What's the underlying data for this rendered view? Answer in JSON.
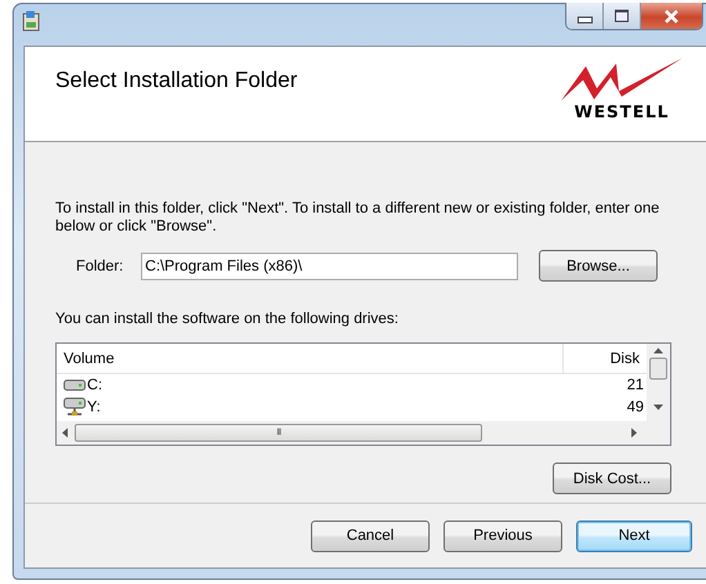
{
  "header": {
    "title": "Select Installation Folder",
    "logo": "WESTELL"
  },
  "intro": "To install in this folder, click \"Next\". To install to a different new or existing folder, enter one below or click \"Browse\".",
  "folder": {
    "label": "Folder:",
    "value": "C:\\Program Files (x86)\\",
    "button": "Browse..."
  },
  "drives_label": "You can install the software on the following drives:",
  "drives": {
    "columns": [
      "Volume",
      "Disk"
    ],
    "rows": [
      {
        "kind": "local",
        "volume": "C:",
        "disk": "21"
      },
      {
        "kind": "network",
        "volume": "Y:",
        "disk": "49"
      }
    ],
    "hscroll_glyph": "III"
  },
  "disk_cost_button": "Disk Cost...",
  "buttons": [
    {
      "label": "Cancel",
      "default": false
    },
    {
      "label": "Previous",
      "default": false
    },
    {
      "label": "Next",
      "default": true
    }
  ]
}
